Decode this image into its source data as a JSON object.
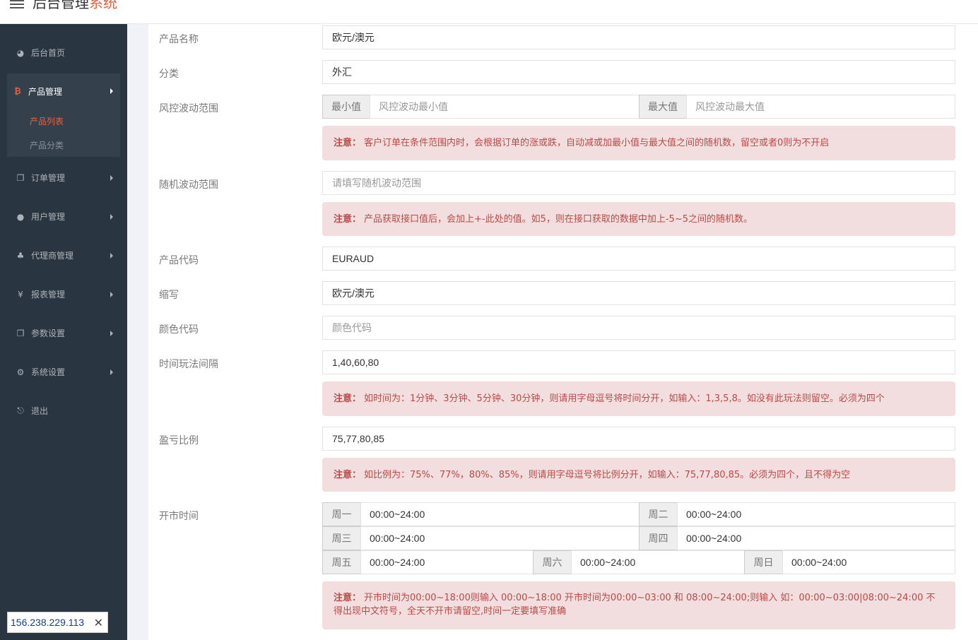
{
  "header": {
    "title_main": "后台管理",
    "title_accent": "系统"
  },
  "sidebar": {
    "home": "后台首页",
    "product_mgmt": "产品管理",
    "product_list": "产品列表",
    "product_category": "产品分类",
    "order_mgmt": "订单管理",
    "user_mgmt": "用户管理",
    "agent_mgmt": "代理商管理",
    "report_mgmt": "报表管理",
    "param_settings": "参数设置",
    "system_settings": "系统设置",
    "logout": "退出"
  },
  "ip_badge": {
    "ip": "156.238.229.113",
    "close": "✕"
  },
  "form": {
    "product_name": {
      "label": "产品名称",
      "value": "欧元/澳元"
    },
    "category": {
      "label": "分类",
      "value": "外汇"
    },
    "risk_range": {
      "label": "风控波动范围",
      "min_addon": "最小值",
      "min_placeholder": "风控波动最小值",
      "max_addon": "最大值",
      "max_placeholder": "风控波动最大值",
      "note_prefix": "注意：",
      "note": "客户订单在条件范围内时，会根据订单的涨或跌，自动减或加最小值与最大值之间的随机数，留空或者0则为不开启"
    },
    "random_range": {
      "label": "随机波动范围",
      "placeholder": "请填写随机波动范围",
      "note_prefix": "注意：",
      "note": "产品获取接口值后，会加上+-此处的值。如5，则在接口获取的数据中加上-5~5之间的随机数。"
    },
    "product_code": {
      "label": "产品代码",
      "value": "EURAUD"
    },
    "abbr": {
      "label": "缩写",
      "value": "欧元/澳元"
    },
    "color_code": {
      "label": "颜色代码",
      "placeholder": "颜色代码"
    },
    "time_interval": {
      "label": "时间玩法间隔",
      "value": "1,40,60,80",
      "note_prefix": "注意：",
      "note": "如时间为：1分钟、3分钟、5分钟、30分钟，则请用字母逗号将时间分开，如输入：1,3,5,8。如没有此玩法则留空。必须为四个"
    },
    "profit_ratio": {
      "label": "盈亏比例",
      "value": "75,77,80,85",
      "note_prefix": "注意：",
      "note": "如比例为：75%、77%，80%、85%，则请用字母逗号将比例分开，如输入：75,77,80,85。必须为四个，且不得为空"
    },
    "market_hours": {
      "label": "开市时间",
      "days": [
        {
          "name": "周一",
          "value": "00:00~24:00"
        },
        {
          "name": "周二",
          "value": "00:00~24:00"
        },
        {
          "name": "周三",
          "value": "00:00~24:00"
        },
        {
          "name": "周四",
          "value": "00:00~24:00"
        },
        {
          "name": "周五",
          "value": "00:00~24:00"
        },
        {
          "name": "周六",
          "value": "00:00~24:00"
        },
        {
          "name": "周日",
          "value": "00:00~24:00"
        }
      ],
      "note_prefix": "注意：",
      "note": "开市时间为00:00~18:00则输入 00:00~18:00 开市时间为00:00~03:00 和 08:00~24:00;则输入 如：00:00~03:00|08:00~24:00 不得出现中文符号，全天不开市请留空,时间一定要填写准确"
    }
  },
  "colors": {
    "accent": "#e5623e",
    "sidebar_bg": "#2a3542",
    "alert_bg": "#f2dede",
    "alert_text": "#b94a48"
  }
}
